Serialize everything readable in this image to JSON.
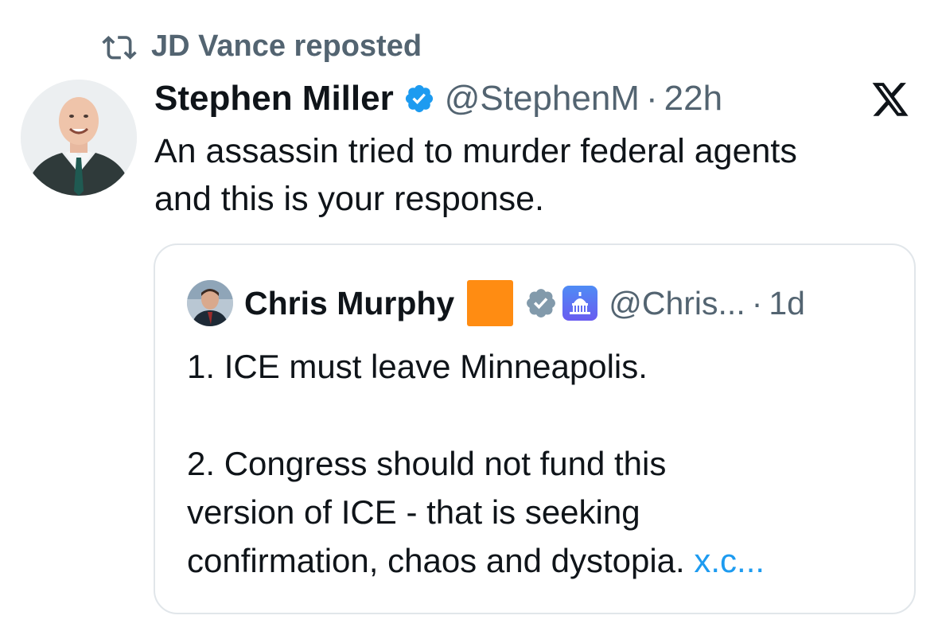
{
  "repost": {
    "icon": "repost-icon",
    "text": "JD Vance reposted"
  },
  "tweet": {
    "author_name": "Stephen Miller",
    "handle": "@StephenM",
    "separator": "·",
    "time": "22h",
    "verified_icon": "verified-badge-icon",
    "brand_icon": "x-logo-icon",
    "text_line1": "An assassin tried to murder federal agents",
    "text_line2": "and this is your response."
  },
  "quote": {
    "author_name": "Chris Murphy",
    "handle": "@Chris...",
    "separator": "·",
    "time": "1d",
    "line1": "1. ICE must leave Minneapolis.",
    "line2": "2. Congress should not fund this",
    "line3": "version of ICE - that is seeking",
    "line4": "confirmation, chaos and dystopia.",
    "link_text": "x.c..."
  },
  "colors": {
    "text": "#0f1419",
    "secondary": "#536471",
    "verified_blue": "#1d9bf0",
    "verified_gray": "#829aab",
    "link": "#1d9bf0",
    "orange_square": "#ff8c12",
    "border": "#e1e6ea"
  }
}
